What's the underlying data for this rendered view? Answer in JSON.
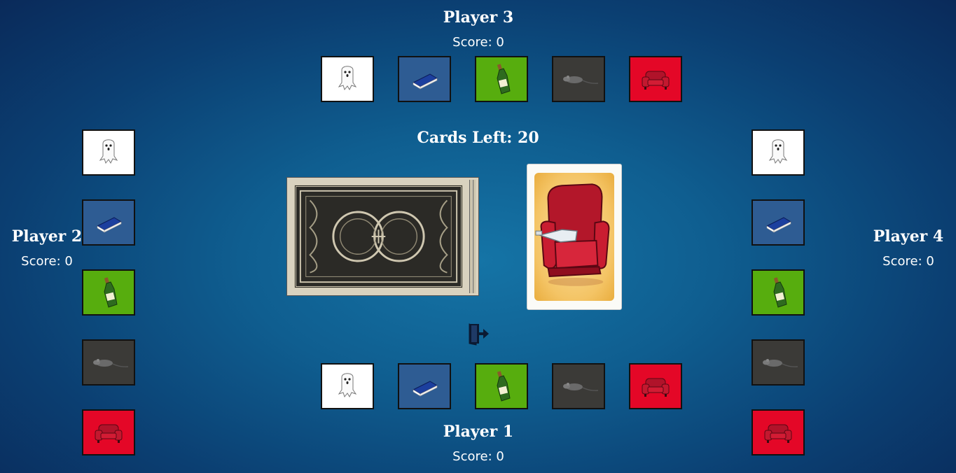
{
  "status": {
    "cards_left": "Cards Left: 20"
  },
  "players": [
    {
      "name": "Player 1",
      "score": "Score: 0"
    },
    {
      "name": "Player 2",
      "score": "Score: 0"
    },
    {
      "name": "Player 3",
      "score": "Score: 0"
    },
    {
      "name": "Player 4",
      "score": "Score: 0"
    }
  ],
  "tile_types": [
    "ghost",
    "book",
    "bottle",
    "mouse",
    "armchair"
  ],
  "colors": {
    "ghost": "#ffffff",
    "book": "#2e5c93",
    "bottle": "#57ad0e",
    "mouse": "#3b3a37",
    "armchair": "#e40727"
  },
  "deck": {
    "icon": "card-back"
  },
  "revealed_card": {
    "icon": "red-armchair-with-bottle"
  },
  "controls": {
    "exit_icon": "exit-door-icon"
  }
}
